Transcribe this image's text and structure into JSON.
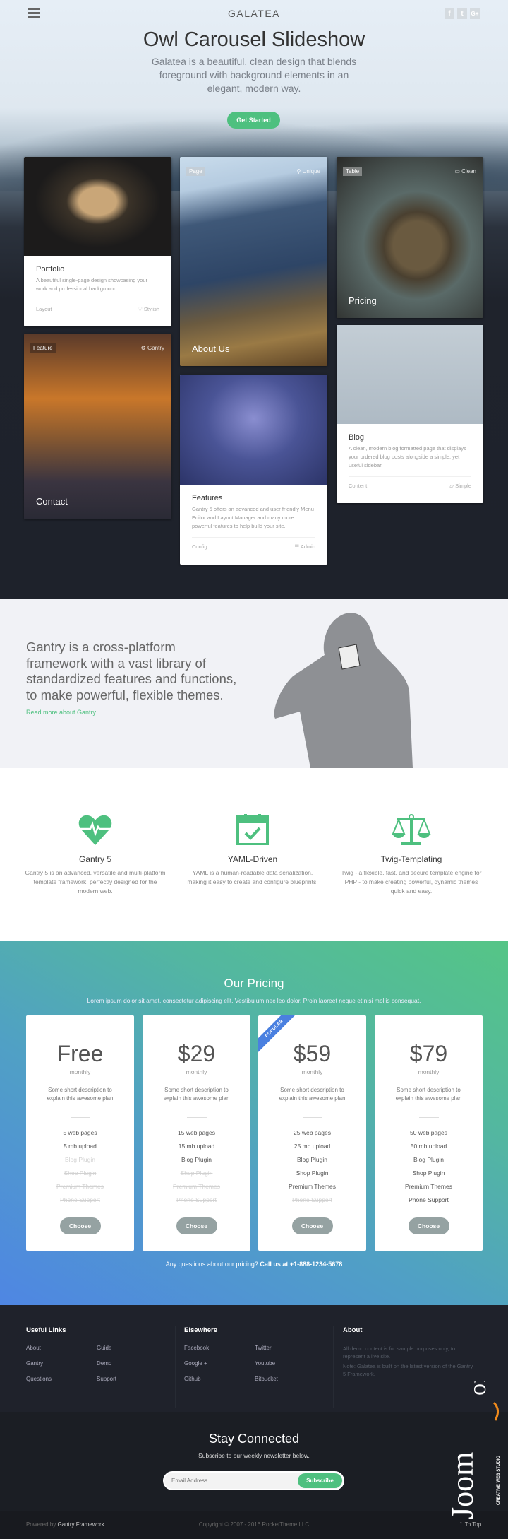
{
  "header": {
    "brand": "GALATEA",
    "social": [
      "f",
      "t",
      "G+"
    ],
    "title": "Owl Carousel Slideshow",
    "subtitle": "Galatea is a beautiful, clean design that blends foreground with background elements in an elegant, modern way.",
    "cta": "Get Started"
  },
  "cards": {
    "portfolio": {
      "title": "Portfolio",
      "desc": "A beautiful single-page design showcasing your work and professional background.",
      "left": "Layout",
      "right": "Stylish"
    },
    "contact": {
      "tag": "Feature",
      "tag2": "Gantry",
      "title": "Contact"
    },
    "about": {
      "tag": "Page",
      "tag2": "Unique",
      "title": "About Us"
    },
    "features": {
      "title": "Features",
      "desc": "Gantry 5 offers an advanced and user friendly Menu Editor and Layout Manager and many more powerful features to help build your site.",
      "left": "Config",
      "right": "Admin"
    },
    "pricing": {
      "tag": "Table",
      "tag2": "Clean",
      "title": "Pricing"
    },
    "blog": {
      "title": "Blog",
      "desc": "A clean, modern blog formatted page that displays your ordered blog posts alongside a simple, yet useful sidebar.",
      "left": "Content",
      "right": "Simple"
    }
  },
  "gantry": {
    "text": "Gantry is a cross-platform framework with a vast library of standardized features and functions, to make powerful, flexible themes.",
    "link": "Read more about Gantry"
  },
  "features": [
    {
      "icon": "heartbeat-icon",
      "title": "Gantry 5",
      "desc": "Gantry 5 is an advanced, versatile and multi-platform template framework, perfectly designed for the modern web."
    },
    {
      "icon": "calendar-check-icon",
      "title": "YAML-Driven",
      "desc": "YAML is a human-readable data serialization, making it easy to create and configure blueprints."
    },
    {
      "icon": "balance-scale-icon",
      "title": "Twig-Templating",
      "desc": "Twig - a flexible, fast, and secure template engine for PHP - to make creating powerful, dynamic themes quick and easy."
    }
  ],
  "pricing": {
    "title": "Our Pricing",
    "subtitle": "Lorem ipsum dolor sit amet, consectetur adipiscing elit. Vestibulum nec leo dolor. Proin laoreet neque et nisi mollis consequat.",
    "ribbon": "POPULAR",
    "period": "monthly",
    "desc": "Some short description to explain this awesome plan",
    "choose": "Choose",
    "question": "Any questions about our pricing?",
    "call": "Call us at +1-888-1234-5678",
    "plans": [
      {
        "price": "Free",
        "features": [
          {
            "t": "5 web pages",
            "on": true
          },
          {
            "t": "5 mb upload",
            "on": true
          },
          {
            "t": "Blog Plugin",
            "on": false
          },
          {
            "t": "Shop Plugin",
            "on": false
          },
          {
            "t": "Premium Themes",
            "on": false
          },
          {
            "t": "Phone Support",
            "on": false
          }
        ]
      },
      {
        "price": "$29",
        "features": [
          {
            "t": "15 web pages",
            "on": true
          },
          {
            "t": "15 mb upload",
            "on": true
          },
          {
            "t": "Blog Plugin",
            "on": true
          },
          {
            "t": "Shop Plugin",
            "on": false
          },
          {
            "t": "Premium Themes",
            "on": false
          },
          {
            "t": "Phone Support",
            "on": false
          }
        ]
      },
      {
        "price": "$59",
        "popular": true,
        "features": [
          {
            "t": "25 web pages",
            "on": true
          },
          {
            "t": "25 mb upload",
            "on": true
          },
          {
            "t": "Blog Plugin",
            "on": true
          },
          {
            "t": "Shop Plugin",
            "on": true
          },
          {
            "t": "Premium Themes",
            "on": true
          },
          {
            "t": "Phone Support",
            "on": false
          }
        ]
      },
      {
        "price": "$79",
        "features": [
          {
            "t": "50 web pages",
            "on": true
          },
          {
            "t": "50 mb upload",
            "on": true
          },
          {
            "t": "Blog Plugin",
            "on": true
          },
          {
            "t": "Shop Plugin",
            "on": true
          },
          {
            "t": "Premium Themes",
            "on": true
          },
          {
            "t": "Phone Support",
            "on": true
          }
        ]
      }
    ]
  },
  "footer": {
    "useful": {
      "title": "Useful Links",
      "links": [
        "About",
        "Guide",
        "Gantry",
        "Demo",
        "Questions",
        "Support"
      ]
    },
    "elsewhere": {
      "title": "Elsewhere",
      "links": [
        "Facebook",
        "Twitter",
        "Google +",
        "Youtube",
        "Github",
        "Bitbucket"
      ]
    },
    "about": {
      "title": "About",
      "p1": "All demo content is for sample purposes only, to represent a live site.",
      "p2": "Note: Galatea is built on the latest version of the Gantry 5 Framework."
    }
  },
  "newsletter": {
    "title": "Stay Connected",
    "subtitle": "Subscribe to our weekly newsletter below.",
    "placeholder": "Email Address",
    "button": "Subscribe"
  },
  "bottom": {
    "powered": "Powered by",
    "framework": "Gantry Framework",
    "copyright": "Copyright © 2007 - 2016 RocketTheme LLC",
    "totop": "To Top"
  },
  "watermark": {
    "text": "JoomFox",
    "tagline": "CREATIVE WEB STUDIO"
  },
  "colors": {
    "accent": "#4ec07f",
    "ribbon": "#4a80e0",
    "dark": "#1e222b"
  }
}
